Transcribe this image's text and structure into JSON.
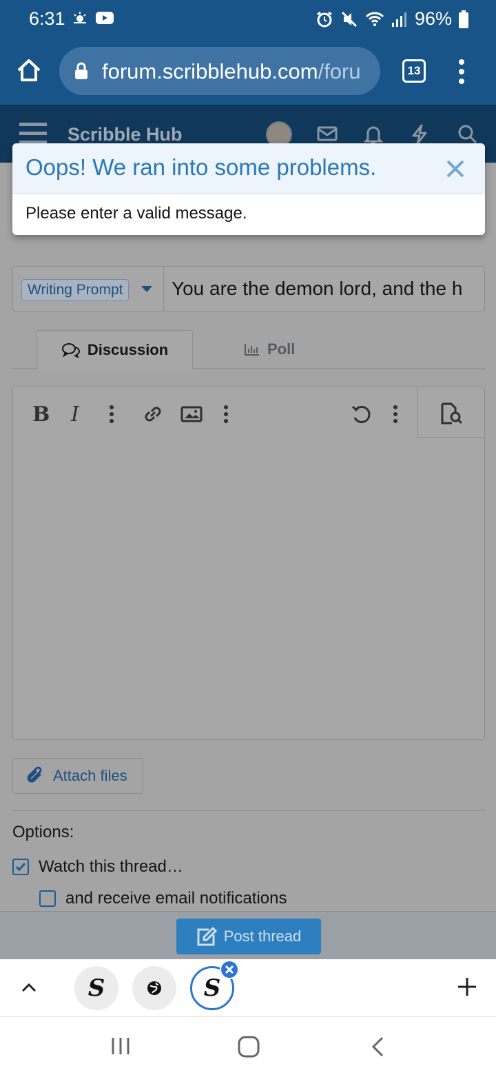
{
  "status_bar": {
    "time": "6:31",
    "battery": "96%"
  },
  "browser": {
    "url_main": "forum.scribblehub.com",
    "url_rest": "/foru",
    "tab_count": "13"
  },
  "site_header": {
    "logo": "Scribble Hub"
  },
  "error_dialog": {
    "title": "Oops! We ran into some problems.",
    "message": "Please enter a valid message."
  },
  "form": {
    "prefix": "Writing Prompt",
    "title_value": "You are the demon lord, and the h",
    "tabs": [
      {
        "label": "Discussion"
      },
      {
        "label": "Poll"
      }
    ],
    "editor": {
      "bold": "B",
      "italic": "I"
    },
    "attach_label": "Attach files",
    "options_label": "Options:",
    "watch_label": "Watch this thread…",
    "email_label": "and receive email notifications",
    "watch_checked": true,
    "email_checked": false,
    "post_label": "Post thread"
  },
  "tab_strip": {
    "thumbs": [
      {
        "glyph": "S"
      },
      {
        "glyph": "globe"
      },
      {
        "glyph": "S"
      }
    ]
  },
  "colors": {
    "brand_blue": "#185487",
    "link_blue": "#2a78b5",
    "accent_blue": "#2f73d1"
  }
}
